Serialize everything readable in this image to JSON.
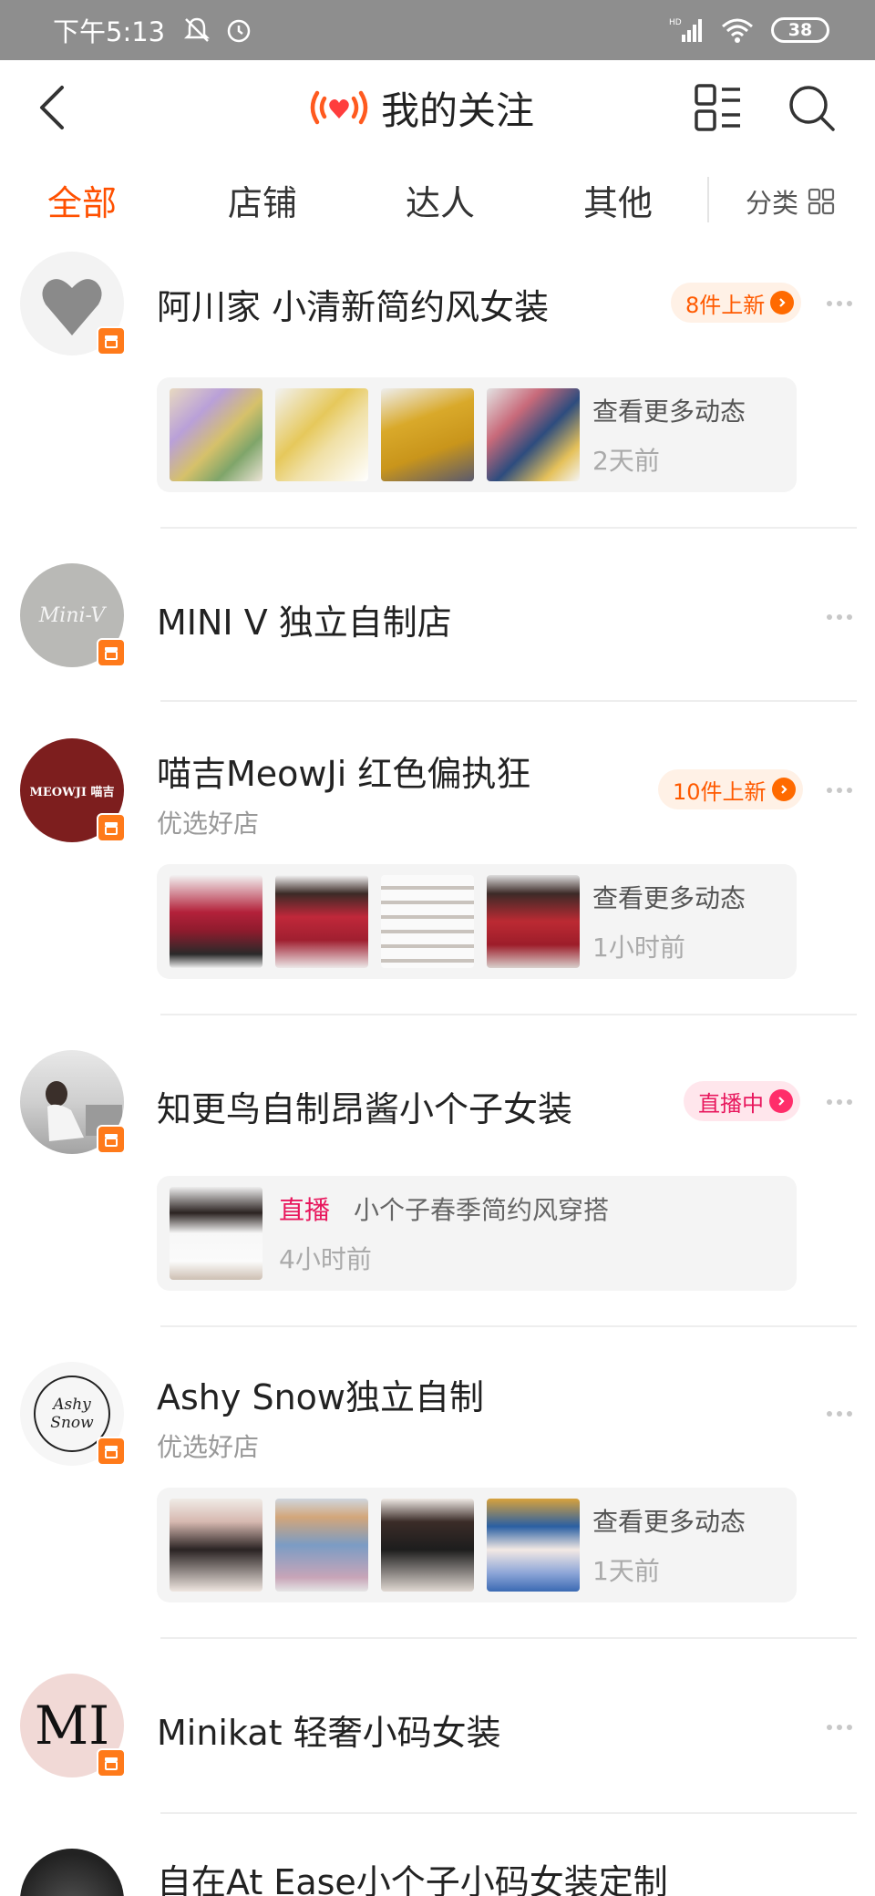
{
  "status_bar": {
    "time": "下午5:13",
    "network": "HD",
    "battery": "38"
  },
  "nav": {
    "title": "我的关注"
  },
  "tabs": [
    {
      "label": "全部",
      "active": true
    },
    {
      "label": "店铺",
      "active": false
    },
    {
      "label": "达人",
      "active": false
    },
    {
      "label": "其他",
      "active": false
    }
  ],
  "category_label": "分类",
  "shops": [
    {
      "name": "阿川家 小清新简约风女装",
      "badge": "8件上新",
      "card_action": "查看更多动态",
      "card_time": "2天前"
    },
    {
      "name": "MINI V 独立自制店"
    },
    {
      "name": "喵吉MeowJi 红色偏执狂",
      "subtitle": "优选好店",
      "badge": "10件上新",
      "card_action": "查看更多动态",
      "card_time": "1小时前"
    },
    {
      "name": "知更鸟自制昂酱小个子女装",
      "badge": "直播中",
      "live_tag": "直播",
      "live_desc": "小个子春季简约风穿搭",
      "card_time": "4小时前"
    },
    {
      "name": "Ashy Snow独立自制",
      "subtitle": "优选好店",
      "card_action": "查看更多动态",
      "card_time": "1天前"
    },
    {
      "name": "Minikat 轻奢小码女装"
    },
    {
      "name": "自在At Ease小个子小码女装定制"
    }
  ],
  "avatar_labels": {
    "minav": "Mini-V",
    "meowji": "MEOWJI 喵吉",
    "ashy": "Ashy Snow",
    "minikat": "MI"
  },
  "colors": {
    "accent": "#ff5000",
    "live": "#e8175d",
    "badge_new_bg": "#fff1e6"
  }
}
